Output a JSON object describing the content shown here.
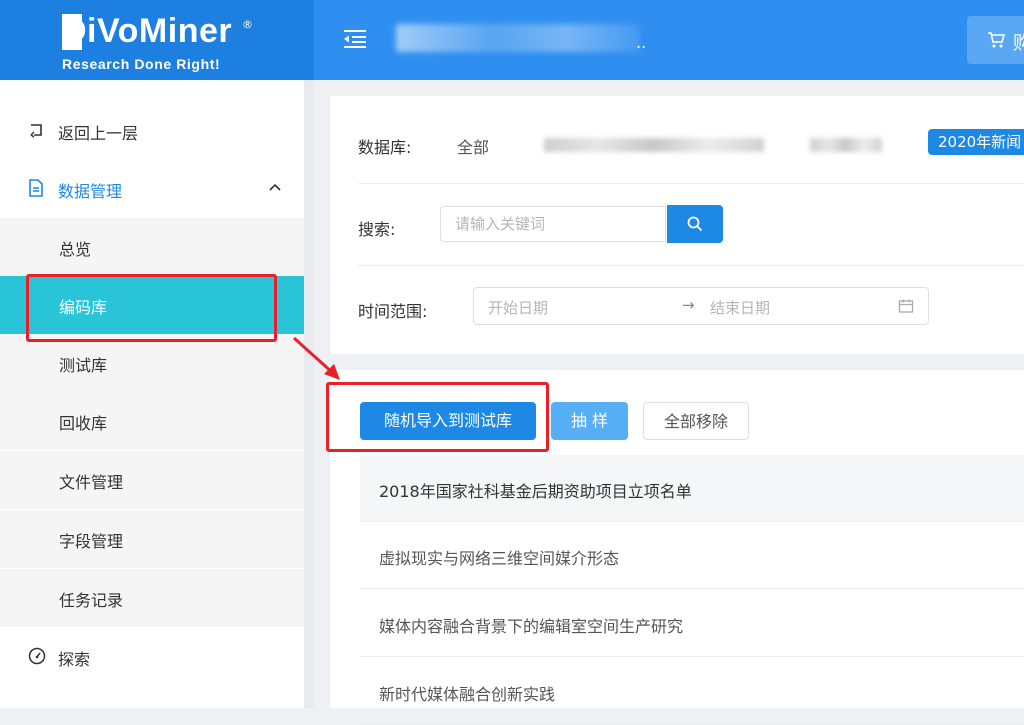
{
  "header": {
    "logo": {
      "text": "DiVoMiner",
      "registered": "®",
      "tagline": "Research Done Right!"
    },
    "project_ellipsis": "..",
    "cart": {
      "label": "购"
    }
  },
  "sidebar": {
    "back": "返回上一层",
    "data_management": "数据管理",
    "subitems": {
      "overview": "总览",
      "codebase": "编码库",
      "testbase": "测试库",
      "recycle": "回收库",
      "files": "文件管理",
      "fields": "字段管理",
      "tasks": "任务记录"
    },
    "explore": "探索"
  },
  "filters": {
    "database_label": "数据库:",
    "database_all": "全部",
    "database_tag": "2020年新闻",
    "search_label": "搜索:",
    "search_placeholder": "请输入关键词",
    "time_label": "时间范围:",
    "date_start_placeholder": "开始日期",
    "date_separator": "→",
    "date_end_placeholder": "结束日期"
  },
  "actions": {
    "random_import": "随机导入到测试库",
    "sample": "抽 样",
    "remove_all": "全部移除"
  },
  "documents": [
    "2018年国家社科基金后期资助项目立项名单",
    "虚拟现实与网络三维空间媒介形态",
    "媒体内容融合背景下的编辑室空间生产研究",
    "新时代媒体融合创新实践"
  ],
  "colors": {
    "header_bg": "#2f8ff0",
    "logo_bg": "#1d7fe0",
    "primary": "#1e88e5",
    "active_item_bg": "#29c4d8",
    "annotation": "#e8202a"
  },
  "icons": {
    "menu": "menu-toggle-icon",
    "cart": "cart-icon",
    "back": "back-icon",
    "data": "document-icon",
    "chevron": "chevron-up-icon",
    "explore": "dashboard-gauge-icon",
    "search": "search-icon",
    "calendar": "calendar-icon"
  }
}
